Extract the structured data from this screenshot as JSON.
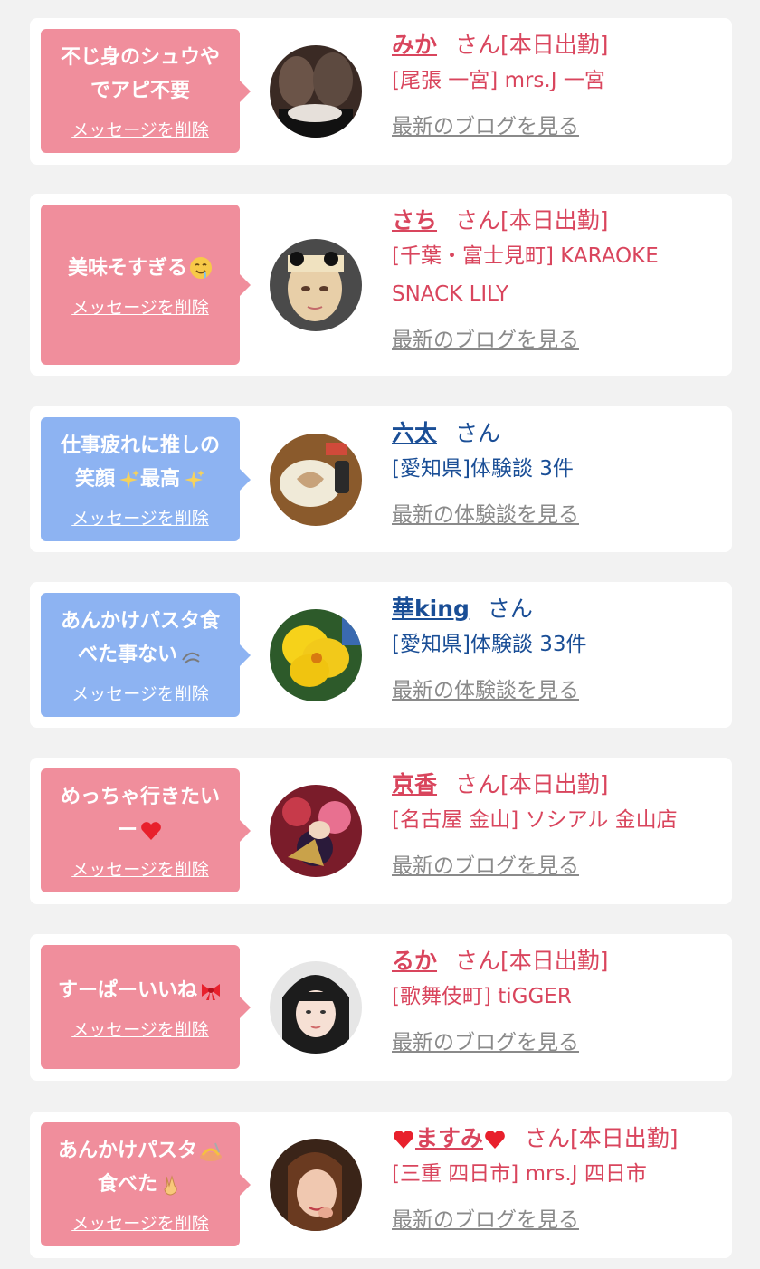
{
  "delete_label": "メッセージを削除",
  "san_label": "さん",
  "cards": [
    {
      "type": "blog",
      "message_lines": [
        "不じ身のシュウや",
        "でアピ不要"
      ],
      "name": "みか",
      "status": "[本日出勤]",
      "shop_lines": [
        "[尾張 一宮] mrs.J 一宮"
      ],
      "link": "最新のブログを見る"
    },
    {
      "type": "blog",
      "message_lines": [
        "美味そすぎる"
      ],
      "message_emoji": "drooling-face-emoji",
      "name": "さち",
      "status": "[本日出勤]",
      "shop_lines": [
        "[千葉・富士見町] KARAOKE",
        "SNACK LILY"
      ],
      "link": "最新のブログを見る"
    },
    {
      "type": "review",
      "message_lines": [
        "仕事疲れに推しの",
        "笑顔",
        "最高"
      ],
      "message_emoji": "sparkles-emoji",
      "name": "六太",
      "status": "",
      "shop_lines": [
        "[愛知県]体験談 3件"
      ],
      "link": "最新の体験談を見る"
    },
    {
      "type": "review",
      "message_lines": [
        "あんかけパスタ食",
        "べた事ない"
      ],
      "message_emoji": "dash-emoji",
      "name": "華king",
      "status": "",
      "shop_lines": [
        "[愛知県]体験談 33件"
      ],
      "link": "最新の体験談を見る"
    },
    {
      "type": "blog",
      "message_lines": [
        "めっちゃ行きたい",
        "ー"
      ],
      "message_emoji": "heart-emoji",
      "name": "京香",
      "status": "[本日出勤]",
      "shop_lines": [
        "[名古屋 金山] ソシアル 金山店"
      ],
      "link": "最新のブログを見る"
    },
    {
      "type": "blog",
      "message_lines": [
        "すーぱーいいね"
      ],
      "message_emoji": "ribbon-emoji",
      "name": "るか",
      "status": "[本日出勤]",
      "shop_lines": [
        "[歌舞伎町] tiGGER"
      ],
      "link": "最新のブログを見る"
    },
    {
      "type": "blog",
      "message_lines": [
        "あんかけパスタ",
        "食べた"
      ],
      "message_emoji": "pasta-emoji",
      "message_emoji2": "victory-hand-emoji",
      "name": "ますみ",
      "name_hearts": "heart-icon",
      "status": "[本日出勤]",
      "shop_lines": [
        "[三重 四日市] mrs.J 四日市"
      ],
      "link": "最新のブログを見る"
    }
  ],
  "colors": {
    "background": "#f2f2f2",
    "card": "#ffffff",
    "bubble_pink": "#f08e9c",
    "bubble_blue": "#8db3f2",
    "text_pink": "#d9455d",
    "text_blue": "#1a4e96",
    "link_gray": "#8a8a8a"
  }
}
